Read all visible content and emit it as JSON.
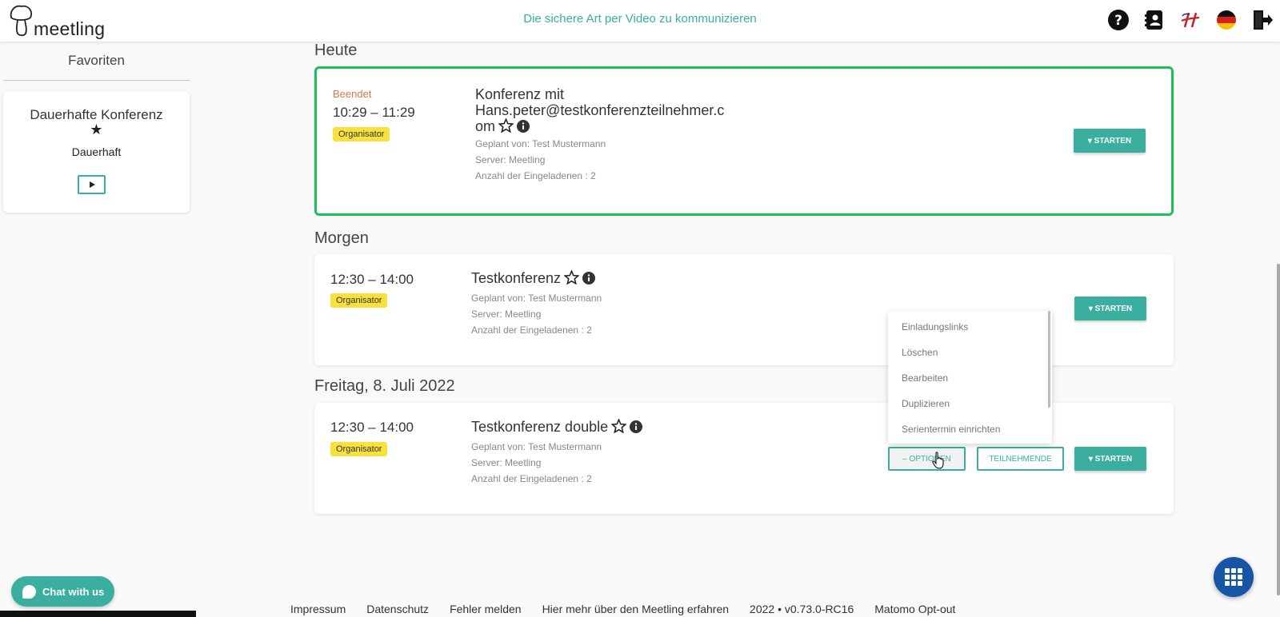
{
  "header": {
    "logo_text": "meetling",
    "tagline": "Die sichere Art per Video zu kommunizieren"
  },
  "sidebar": {
    "title": "Favoriten",
    "favorite": {
      "name": "Dauerhafte Konferenz",
      "subtitle": "Dauerhaft"
    }
  },
  "sections": {
    "today": "Heute",
    "tomorrow": "Morgen",
    "friday": "Freitag, 8. Juli 2022"
  },
  "meetings": [
    {
      "status": "Beendet",
      "time": "10:29 – 11:29",
      "badge": "Organisator",
      "title_line1": "Konferenz mit",
      "title_line2": "Hans.peter@testkonferenzteilnehmer.c",
      "title_line3": "om",
      "planned_by": "Geplant von: Test Mustermann",
      "server": "Server: Meetling",
      "invitees": "Anzahl der Eingeladenen : 2",
      "start_label": "STARTEN"
    },
    {
      "time": "12:30 – 14:00",
      "badge": "Organisator",
      "title": "Testkonferenz",
      "planned_by": "Geplant von: Test Mustermann",
      "server": "Server: Meetling",
      "invitees": "Anzahl der Eingeladenen : 2",
      "start_label": "STARTEN"
    },
    {
      "time": "12:30 – 14:00",
      "badge": "Organisator",
      "title": "Testkonferenz double",
      "planned_by": "Geplant von: Test Mustermann",
      "server": "Server: Meetling",
      "invitees": "Anzahl der Eingeladenen : 2",
      "options_label": "– OPTIONEN",
      "participants_label": "TEILNEHMENDE",
      "start_label": "STARTEN"
    }
  ],
  "options_menu": [
    "Einladungslinks",
    "Löschen",
    "Bearbeiten",
    "Duplizieren",
    "Serientermin einrichten"
  ],
  "chat": {
    "label": "Chat with us"
  },
  "footer": [
    "Impressum",
    "Datenschutz",
    "Fehler melden",
    "Hier mehr über den Meetling erfahren",
    "2022 • v0.73.0-RC16",
    "Matomo Opt-out"
  ],
  "colors": {
    "accent": "#3aafa0",
    "active_border": "#1dbf56",
    "badge": "#f7e13a",
    "ended": "#d9774a",
    "fab": "#1756a6"
  }
}
